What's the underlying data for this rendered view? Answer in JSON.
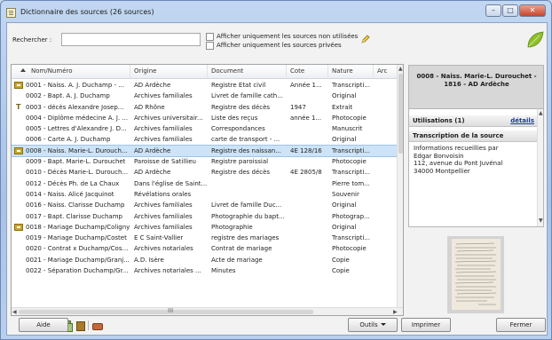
{
  "window": {
    "title": "Dictionnaire des sources (26 sources)",
    "controls": {
      "minimize": "–",
      "maximize": "□",
      "close": "✕"
    }
  },
  "search": {
    "label": "Rechercher :",
    "value": "",
    "filter_unused": "Afficher uniquement les sources non utilisées",
    "filter_private": "Afficher uniquement les sources privées"
  },
  "table": {
    "columns": [
      "Nom/Numéro",
      "Origine",
      "Document",
      "Cote",
      "Nature",
      "Arc"
    ],
    "rows": [
      {
        "mark": "page",
        "name": "0001 - Naiss. A. J. Duchamp - ...",
        "origine": "AD Ardèche",
        "document": "Registre Etat civil",
        "cote": "Année 1...",
        "nature": "Transcripti..."
      },
      {
        "mark": "",
        "name": "0002 - Bapt. A. J. Duchamp",
        "origine": "Archives familiales",
        "document": "Livret de famille cath...",
        "cote": "",
        "nature": "Original"
      },
      {
        "mark": "t",
        "name": "0003 - décès Alexandre Josep...",
        "origine": "AD Rhône",
        "document": "Registre des décès",
        "cote": "1947",
        "nature": "Extrait"
      },
      {
        "mark": "",
        "name": "0004 - Diplôme médecine A. J. ...",
        "origine": "Archives universitair...",
        "document": "Liste des reçus",
        "cote": "année 1...",
        "nature": "Photocopie"
      },
      {
        "mark": "",
        "name": "0005 - Lettres d'Alexandre J. D...",
        "origine": "Archives familiales",
        "document": "Correspondances",
        "cote": "",
        "nature": "Manuscrit"
      },
      {
        "mark": "",
        "name": "0006 - Carte A. J. Duchamp",
        "origine": "Archives familiales",
        "document": "carte de transport - ...",
        "cote": "",
        "nature": "Original"
      },
      {
        "mark": "page",
        "name": "0008 - Naiss. Marie-L. Durouch...",
        "origine": "AD Ardèche",
        "document": "Registre des naissan...",
        "cote": "4E 128/16",
        "nature": "Transcripti...",
        "selected": true
      },
      {
        "mark": "",
        "name": "0009 - Bapt. Marie-L. Durouchet",
        "origine": "Paroisse de Satillieu",
        "document": "Registre paroissial",
        "cote": "",
        "nature": "Photocopie"
      },
      {
        "mark": "",
        "name": "0010 - Décès Marie-L. Durouch...",
        "origine": "AD Ardèche",
        "document": "Registre des décès",
        "cote": "4E 2805/8",
        "nature": "Transcripti..."
      },
      {
        "mark": "",
        "name": "0012 - Décès Ph. de La Chaux",
        "origine": "Dans l'église de Saint...",
        "document": "",
        "cote": "",
        "nature": "Pierre tom..."
      },
      {
        "mark": "",
        "name": "0014 - Naiss. Alicé Jacquinot",
        "origine": "Révélations orales",
        "document": "",
        "cote": "",
        "nature": "Souvenir"
      },
      {
        "mark": "",
        "name": "0016 - Naiss. Clarisse Duchamp",
        "origine": "Archives familiales",
        "document": "Livret de famille Duc...",
        "cote": "",
        "nature": "Original"
      },
      {
        "mark": "",
        "name": "0017 - Bapt. Clarisse Duchamp",
        "origine": "Archives familiales",
        "document": "Photographie du bapt...",
        "cote": "",
        "nature": "Photograp..."
      },
      {
        "mark": "page",
        "name": "0018 - Mariage Duchamp/Coligny",
        "origine": "Archives familiales",
        "document": "Photographie",
        "cote": "",
        "nature": "Original"
      },
      {
        "mark": "",
        "name": "0019 - Mariage Duchamp/Costet",
        "origine": "E C Saint-Vallier",
        "document": "registre des mariages",
        "cote": "",
        "nature": "Transcripti..."
      },
      {
        "mark": "",
        "name": "0020 - Contrat x Duchamp/Costet",
        "origine": "Archives notariales",
        "document": "Contrat de mariage",
        "cote": "",
        "nature": "Photocopie"
      },
      {
        "mark": "",
        "name": "0021 - Mariage Duchamp/Granj...",
        "origine": "A.D. Isère",
        "document": "Acte de mariage",
        "cote": "",
        "nature": "Copie"
      },
      {
        "mark": "",
        "name": "0022 - Séparation Duchamp/Gr...",
        "origine": "Archives notariales ...",
        "document": "Minutes",
        "cote": "",
        "nature": "Copie"
      }
    ]
  },
  "side": {
    "header": "0008 - Naiss. Marie-L. Durouchet - 1816 - AD Ardèche",
    "usages_label": "Utilisations (1)",
    "details_link": "détails",
    "transcription_label": "Transcription de la source",
    "transcription_lines": [
      "Informations recueillies par",
      "Edgar Bonvoisin",
      "112, avenue du Pont Juvénal",
      "34000 Montpellier"
    ]
  },
  "footer": {
    "help": "Aide",
    "tools": "Outils",
    "print": "Imprimer",
    "close": "Fermer"
  },
  "grip": "III",
  "colors": {
    "selected_row": "#cde3f7",
    "leaf_green": "#8fbf2a",
    "window_blue": "#b3cbea"
  }
}
